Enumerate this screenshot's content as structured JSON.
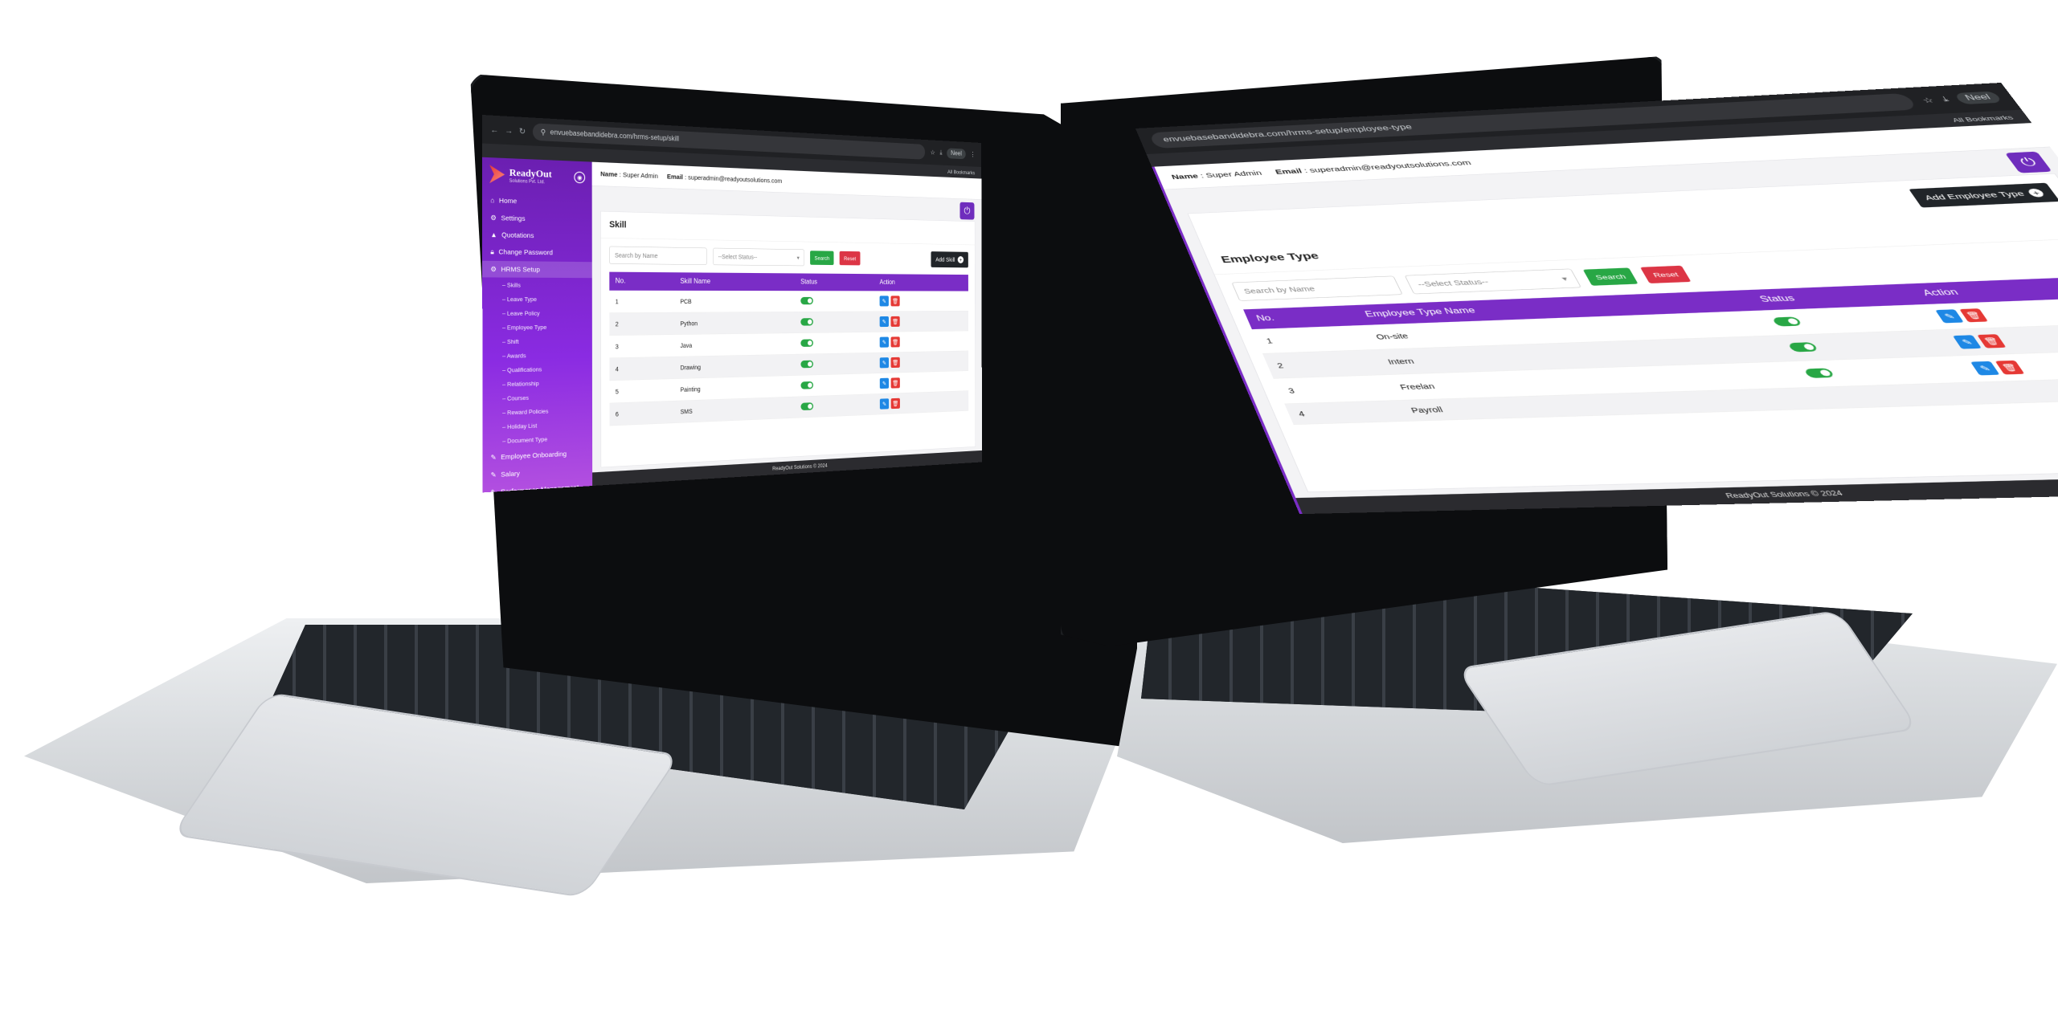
{
  "left_screen": {
    "url": "envuebasebandidebra.com/hrms-setup/skill",
    "profile_label": "Neel",
    "bookmarks_label": "All Bookmarks",
    "brand": {
      "name": "ReadyOut",
      "tagline": "Solutions Pvt. Ltd."
    },
    "sidebar": {
      "items": [
        {
          "label": "Home"
        },
        {
          "label": "Settings"
        },
        {
          "label": "Quotations"
        },
        {
          "label": "Change Password"
        },
        {
          "label": "HRMS Setup"
        }
      ],
      "sub_items": [
        {
          "label": "Skills"
        },
        {
          "label": "Leave Type"
        },
        {
          "label": "Leave Policy"
        },
        {
          "label": "Employee Type"
        },
        {
          "label": "Shift"
        },
        {
          "label": "Awards"
        },
        {
          "label": "Qualifications"
        },
        {
          "label": "Relationship"
        },
        {
          "label": "Courses"
        },
        {
          "label": "Reward Policies"
        },
        {
          "label": "Holiday List"
        },
        {
          "label": "Document Type"
        }
      ],
      "tail_items": [
        {
          "label": "Employee Onboarding"
        },
        {
          "label": "Salary"
        },
        {
          "label": "Performance Management"
        }
      ]
    },
    "topbar": {
      "name_label": "Name",
      "name_value": "Super Admin",
      "email_label": "Email",
      "email_value": "superadmin@readyoutsolutions.com"
    },
    "page_title": "Skill",
    "search_placeholder": "Search by Name",
    "status_select": "--Select Status--",
    "search_btn": "Search",
    "reset_btn": "Reset",
    "add_btn": "Add Skill",
    "columns": {
      "no": "No.",
      "name": "Skill Name",
      "status": "Status",
      "action": "Action"
    },
    "rows": [
      {
        "no": "1",
        "name": "PCB"
      },
      {
        "no": "2",
        "name": "Python"
      },
      {
        "no": "3",
        "name": "Java"
      },
      {
        "no": "4",
        "name": "Drawing"
      },
      {
        "no": "5",
        "name": "Painting"
      },
      {
        "no": "6",
        "name": "SMS"
      }
    ],
    "footer": "ReadyOut Solutions © 2024"
  },
  "right_screen": {
    "url": "envuebasebandidebra.com/hrms-setup/employee-type",
    "profile_label": "Neel",
    "bookmarks_label": "All Bookmarks",
    "topbar": {
      "name_label": "Name",
      "name_value": "Super Admin",
      "email_label": "Email",
      "email_value": "superadmin@readyoutsolutions.com"
    },
    "page_title": "Employee Type",
    "search_placeholder": "Search by Name",
    "status_select": "--Select Status--",
    "search_btn": "Search",
    "reset_btn": "Reset",
    "add_btn": "Add Employee Type",
    "columns": {
      "no": "No.",
      "name": "Employee Type Name",
      "status": "Status",
      "action": "Action"
    },
    "rows": [
      {
        "no": "1",
        "name": "On-site"
      },
      {
        "no": "2",
        "name": "Intern"
      },
      {
        "no": "3",
        "name": "Freelan"
      },
      {
        "no": "4",
        "name": "Payroll"
      }
    ],
    "footer": "ReadyOut Solutions © 2024"
  },
  "icons": {
    "home": "home-icon",
    "gear": "gear-icon",
    "power": "power-icon",
    "edit": "edit-icon",
    "trash": "trash-icon"
  },
  "colors": {
    "brand_purple": "#7a2dc6",
    "sidebar_gradient_top": "#6b1fb1",
    "success": "#28a745",
    "danger": "#dc3545",
    "edit": "#1e88e5"
  }
}
